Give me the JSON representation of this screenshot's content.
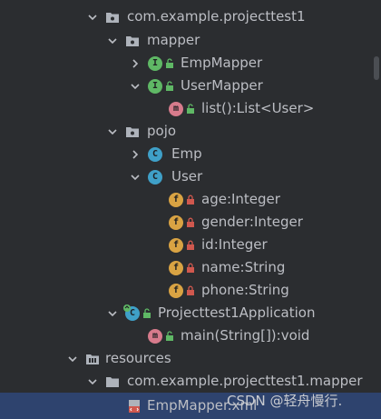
{
  "tree": {
    "package_root": "com.example.projecttest1",
    "mapper_folder": "mapper",
    "emp_mapper": "EmpMapper",
    "user_mapper": "UserMapper",
    "user_mapper_method": "list():List<User>",
    "pojo_folder": "pojo",
    "emp_class": "Emp",
    "user_class": "User",
    "fields": [
      "age:Integer",
      "gender:Integer",
      "id:Integer",
      "name:String",
      "phone:String"
    ],
    "app_class": "Projecttest1Application",
    "app_method": "main(String[]):void",
    "resources_folder": "resources",
    "resources_package": "com.example.projecttest1.mapper",
    "xml_file": "EmpMapper.xml"
  },
  "icons": {
    "interface_letter": "I",
    "class_letter": "C",
    "field_letter": "f",
    "method_letter": "m"
  },
  "watermark": "CSDN @轻舟慢行.",
  "colors": {
    "background": "#2b2d30",
    "selection": "#2e436e",
    "text": "#bcbec4",
    "interface_icon": "#5fb865",
    "class_icon": "#3fa0c8",
    "field_icon": "#d9a343",
    "method_icon": "#d77b8c"
  }
}
